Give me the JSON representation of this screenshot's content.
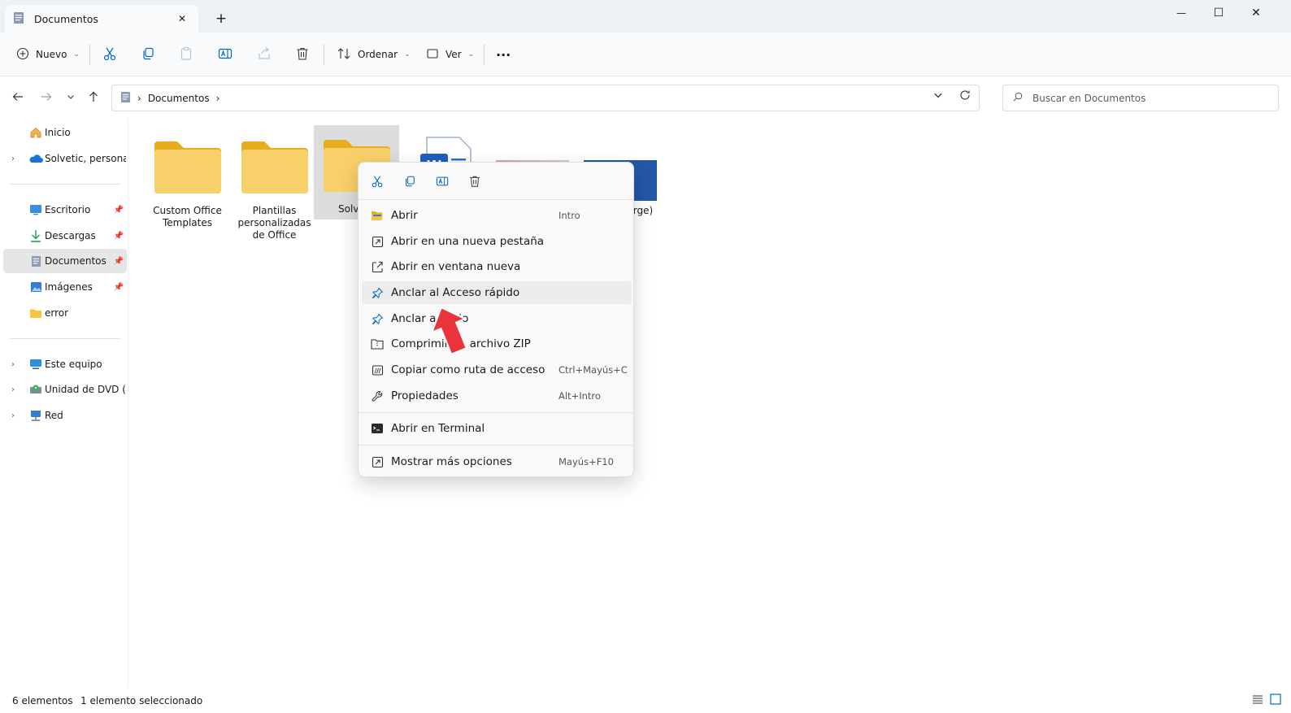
{
  "window": {
    "tab_title": "Documentos",
    "new_tab_symbol": "+",
    "close_symbol": "✕",
    "minimize_symbol": "—",
    "maximize_symbol": "☐",
    "close_window_symbol": "✕"
  },
  "toolbar": {
    "new_label": "Nuevo",
    "sort_label": "Ordenar",
    "view_label": "Ver",
    "more_symbol": "···",
    "icons": [
      "cut-icon",
      "copy-icon",
      "paste-icon",
      "rename-icon",
      "share-icon",
      "delete-icon"
    ]
  },
  "address": {
    "segments": [
      "Documentos"
    ],
    "separator": "›",
    "search_placeholder": "Buscar en Documentos"
  },
  "sidebar": {
    "items": [
      {
        "label": "Inicio",
        "icon": "home-icon",
        "expandable": false,
        "pinned": false
      },
      {
        "label": "Solvetic, personal",
        "icon": "onedrive-icon",
        "expandable": true,
        "pinned": false
      },
      {
        "label": "Escritorio",
        "icon": "desktop-icon",
        "expandable": false,
        "pinned": true
      },
      {
        "label": "Descargas",
        "icon": "downloads-icon",
        "expandable": false,
        "pinned": true
      },
      {
        "label": "Documentos",
        "icon": "documents-icon",
        "expandable": false,
        "pinned": true,
        "active": true
      },
      {
        "label": "Imágenes",
        "icon": "pictures-icon",
        "expandable": false,
        "pinned": true
      },
      {
        "label": "error",
        "icon": "folder-icon",
        "expandable": false,
        "pinned": false
      },
      {
        "label": "Este equipo",
        "icon": "pc-icon",
        "expandable": true,
        "pinned": false
      },
      {
        "label": "Unidad de DVD (D:)",
        "icon": "dvd-icon",
        "expandable": true,
        "pinned": false
      },
      {
        "label": "Red",
        "icon": "network-icon",
        "expandable": true,
        "pinned": false
      }
    ]
  },
  "files": [
    {
      "name": "Custom Office Templates",
      "type": "folder"
    },
    {
      "name": "Plantillas personalizadas de Office",
      "type": "folder"
    },
    {
      "name": "Solv",
      "type": "folder",
      "selected": true
    },
    {
      "name": "",
      "type": "word"
    },
    {
      "name": "",
      "type": "image"
    },
    {
      "name": "rge)",
      "type": "image-blue"
    }
  ],
  "context_menu": {
    "top_icons": [
      "cut-icon",
      "copy-icon",
      "rename-icon",
      "delete-icon"
    ],
    "items": [
      {
        "label": "Abrir",
        "shortcut": "Intro",
        "icon": "open-folder-icon"
      },
      {
        "label": "Abrir en una nueva pestaña",
        "shortcut": "",
        "icon": "new-tab-icon"
      },
      {
        "label": "Abrir en ventana nueva",
        "shortcut": "",
        "icon": "new-window-icon"
      },
      {
        "label": "Anclar al Acceso rápido",
        "shortcut": "",
        "icon": "pin-icon",
        "hover": true
      },
      {
        "label": "Anclar a Inicio",
        "shortcut": "",
        "icon": "pin-icon"
      },
      {
        "label": "Comprimir en archivo ZIP",
        "shortcut": "",
        "icon": "zip-icon"
      },
      {
        "label": "Copiar como ruta de acceso",
        "shortcut": "Ctrl+Mayús+C",
        "icon": "copy-path-icon"
      },
      {
        "label": "Propiedades",
        "shortcut": "Alt+Intro",
        "icon": "wrench-icon"
      },
      {
        "label": "Abrir en Terminal",
        "shortcut": "",
        "icon": "terminal-icon"
      },
      {
        "label": "Mostrar más opciones",
        "shortcut": "Mayús+F10",
        "icon": "more-options-icon"
      }
    ]
  },
  "status": {
    "count": "6 elementos",
    "selection": "1 elemento seleccionado"
  },
  "colors": {
    "folder": "#f6c343",
    "folder_dark": "#e8ad1e",
    "accent": "#0067c0",
    "pointer_arrow": "#e8343a"
  }
}
